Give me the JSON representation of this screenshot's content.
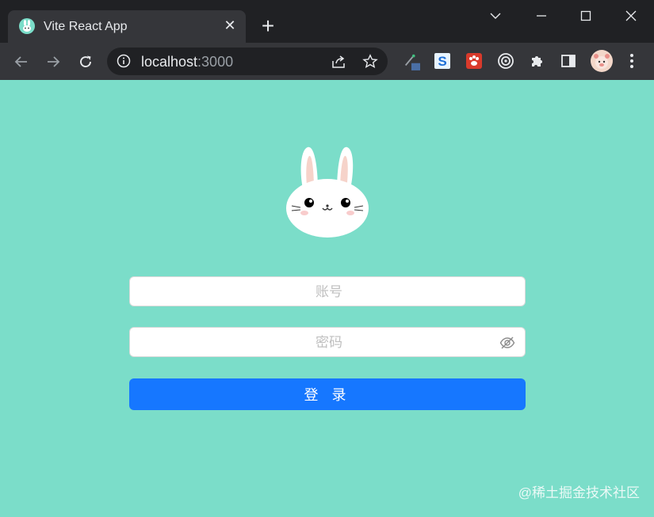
{
  "browser": {
    "tab_title": "Vite React App",
    "tab_close": "✕",
    "new_tab": "+",
    "url_host": "localhost",
    "url_port": ":3000"
  },
  "login": {
    "username_placeholder": "账号",
    "password_placeholder": "密码",
    "submit_label": "登 录"
  },
  "watermark": "@稀土掘金技术社区",
  "colors": {
    "page_background": "#7bddc9",
    "primary_button": "#1677ff",
    "browser_frame": "#202124",
    "browser_toolbar": "#35363a"
  }
}
